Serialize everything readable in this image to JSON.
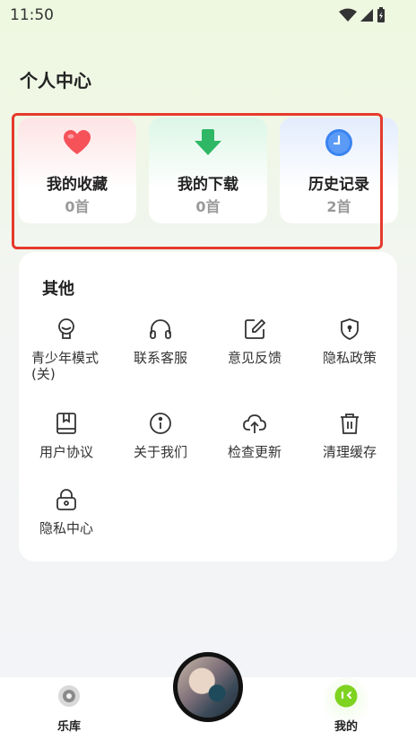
{
  "status_bar": {
    "time": "11:50"
  },
  "page": {
    "title": "个人中心"
  },
  "shortcuts": [
    {
      "label": "我的收藏",
      "count": "0首",
      "icon": "heart-icon",
      "color": "#f5525a"
    },
    {
      "label": "我的下载",
      "count": "0首",
      "icon": "download-arrow-icon",
      "color": "#2fb766"
    },
    {
      "label": "历史记录",
      "count": "2首",
      "icon": "clock-icon",
      "color": "#3a84f0"
    }
  ],
  "others": {
    "title": "其他",
    "items": [
      {
        "label": "青少年模式(关)",
        "icon": "teen-mode-icon"
      },
      {
        "label": "联系客服",
        "icon": "headphones-icon"
      },
      {
        "label": "意见反馈",
        "icon": "edit-icon"
      },
      {
        "label": "隐私政策",
        "icon": "shield-icon"
      },
      {
        "label": "用户协议",
        "icon": "book-icon"
      },
      {
        "label": "关于我们",
        "icon": "info-icon"
      },
      {
        "label": "检查更新",
        "icon": "cloud-upload-icon"
      },
      {
        "label": "清理缓存",
        "icon": "trash-icon"
      },
      {
        "label": "隐私中心",
        "icon": "lock-icon"
      }
    ]
  },
  "bottom_nav": {
    "items": [
      {
        "label": "乐库",
        "icon": "disc-icon"
      },
      {
        "label": "我的",
        "icon": "face-icon",
        "active": true
      }
    ],
    "active_color": "#7ed321"
  },
  "highlight_color": "#e53b2c"
}
